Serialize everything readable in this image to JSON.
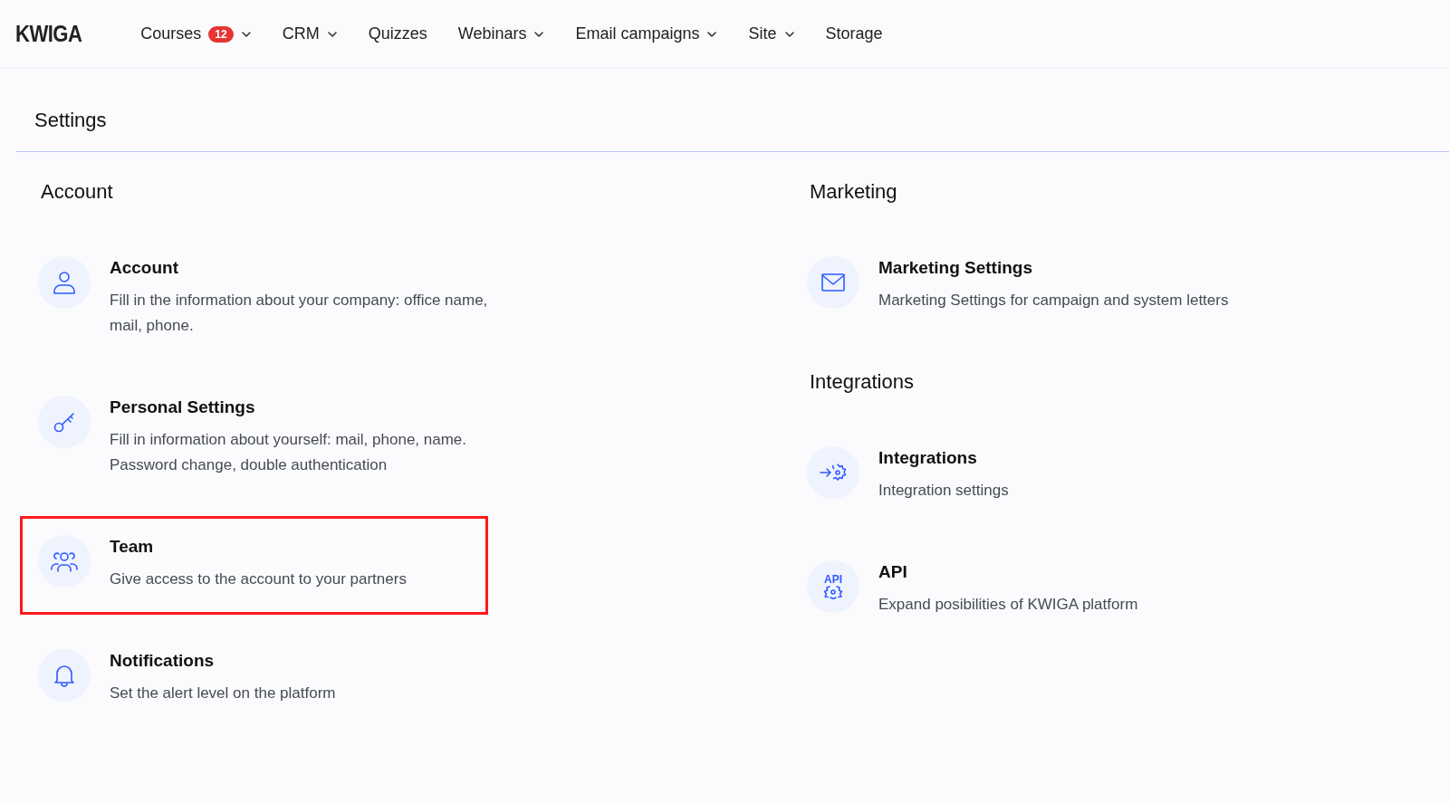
{
  "logo": "KWIGA",
  "nav": [
    {
      "label": "Courses",
      "badge": "12",
      "dropdown": true
    },
    {
      "label": "CRM",
      "dropdown": true
    },
    {
      "label": "Quizzes",
      "dropdown": false
    },
    {
      "label": "Webinars",
      "dropdown": true
    },
    {
      "label": "Email campaigns",
      "dropdown": true
    },
    {
      "label": "Site",
      "dropdown": true
    },
    {
      "label": "Storage",
      "dropdown": false
    }
  ],
  "page_title": "Settings",
  "columns": [
    {
      "sections": [
        {
          "heading": "Account",
          "items": [
            {
              "kind": "person",
              "title": "Account",
              "description": "Fill in the information about your company: office name, mail, phone.",
              "highlighted": false
            },
            {
              "kind": "key",
              "title": "Personal Settings",
              "description": "Fill in information about yourself: mail, phone, name. Password change, double authentication",
              "highlighted": false
            },
            {
              "kind": "people",
              "title": "Team",
              "description": "Give access to the account to your partners",
              "highlighted": true
            },
            {
              "kind": "bell",
              "title": "Notifications",
              "description": "Set the alert level on the platform",
              "highlighted": false
            }
          ]
        }
      ]
    },
    {
      "sections": [
        {
          "heading": "Marketing",
          "items": [
            {
              "kind": "envelope",
              "title": "Marketing Settings",
              "description": "Marketing Settings for campaign and system letters",
              "highlighted": false
            }
          ]
        },
        {
          "heading": "Integrations",
          "items": [
            {
              "kind": "gear-arrow",
              "title": "Integrations",
              "description": "Integration settings",
              "highlighted": false
            },
            {
              "kind": "api",
              "icon_text": "API",
              "title": "API",
              "description": "Expand posibilities of KWIGA platform",
              "highlighted": false
            }
          ]
        }
      ]
    }
  ]
}
